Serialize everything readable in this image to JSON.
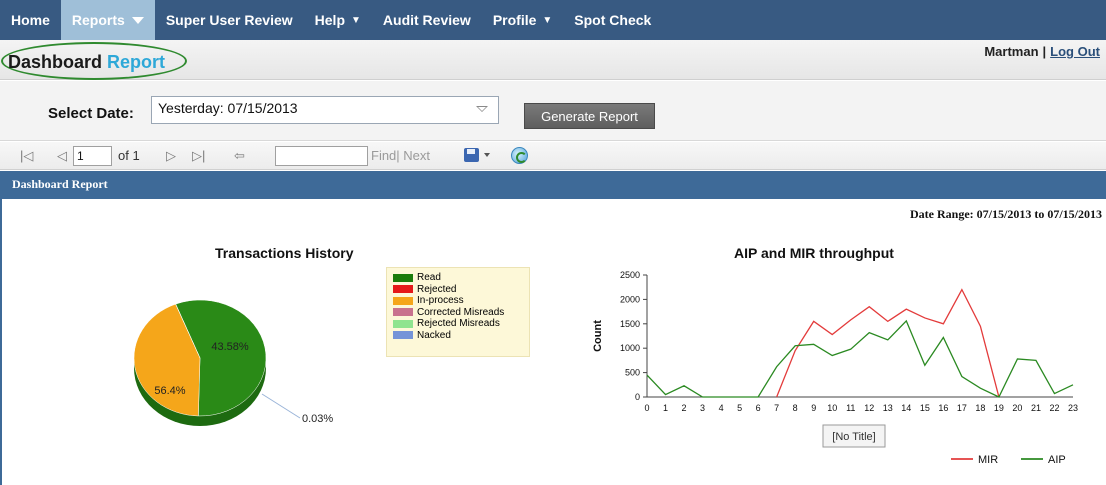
{
  "nav": {
    "items": [
      {
        "label": "Home",
        "caret": ""
      },
      {
        "label": "Reports",
        "caret": "▽"
      },
      {
        "label": "Super User Review",
        "caret": ""
      },
      {
        "label": "Help",
        "caret": "▼"
      },
      {
        "label": "Audit Review",
        "caret": ""
      },
      {
        "label": "Profile",
        "caret": "▼"
      },
      {
        "label": "Spot Check",
        "caret": ""
      }
    ],
    "active_color": "#9fbfd8",
    "bar_color": "#385a82"
  },
  "header": {
    "title_main": "Dashboard",
    "title_accent": "Report",
    "user": "Martman",
    "separator": "|",
    "logout": "Log Out"
  },
  "filters": {
    "date_label": "Select Date:",
    "date_value": "Yesterday: 07/15/2013",
    "generate_label": "Generate Report"
  },
  "toolbar": {
    "first_icon": "|◁",
    "prev_icon": "◁",
    "page_value": "1",
    "page_of": "of 1",
    "next_icon": "▷",
    "last_icon": "▷|",
    "back_icon": "⇦",
    "find_label": "Find| Next",
    "find_placeholder": "",
    "save_icon": "export-disk-icon",
    "refresh_icon": "refresh-icon"
  },
  "report": {
    "band_title": "Dashboard Report",
    "date_range": "Date Range: 07/15/2013 to 07/15/2013"
  },
  "chart_data": [
    {
      "type": "pie",
      "title": "Transactions History",
      "legend": [
        "Read",
        "Rejected",
        "In-process",
        "Corrected Misreads",
        "Rejected Misreads",
        "Nacked"
      ],
      "legend_colors": [
        "#1a7c0b",
        "#e51919",
        "#f5a61a",
        "#c9728d",
        "#8fe48f",
        "#7594d8"
      ],
      "slices": [
        {
          "label": "56.4%",
          "value": 56.4,
          "color": "#2a8a17"
        },
        {
          "label": "43.58%",
          "value": 43.58,
          "color": "#f5a61a"
        },
        {
          "label": "0.03%",
          "value": 0.03,
          "color": "#c9728d"
        }
      ],
      "legend_placement": "right"
    },
    {
      "type": "line",
      "title": "AIP and MIR throughput",
      "ylabel": "Count",
      "xlabel": "",
      "ylim": [
        0,
        2500
      ],
      "yticks": [
        0,
        500,
        1000,
        1500,
        2000,
        2500
      ],
      "x": [
        0,
        1,
        2,
        3,
        4,
        5,
        6,
        7,
        8,
        9,
        10,
        11,
        12,
        13,
        14,
        15,
        16,
        17,
        18,
        19,
        20,
        21,
        22,
        23
      ],
      "series": [
        {
          "name": "MIR",
          "color": "#e33b3b",
          "values": [
            null,
            null,
            null,
            null,
            null,
            null,
            null,
            0,
            950,
            1550,
            1280,
            1580,
            1850,
            1550,
            1800,
            1620,
            1500,
            2200,
            1450,
            0,
            null,
            null,
            null,
            null
          ]
        },
        {
          "name": "AIP",
          "color": "#2b8a22",
          "values": [
            450,
            50,
            230,
            0,
            0,
            0,
            0,
            620,
            1050,
            1080,
            850,
            980,
            1320,
            1170,
            1560,
            650,
            1220,
            420,
            180,
            0,
            780,
            750,
            70,
            250
          ]
        }
      ],
      "tooltip": "[No Title]",
      "legend_placement": "bottom-right"
    }
  ]
}
